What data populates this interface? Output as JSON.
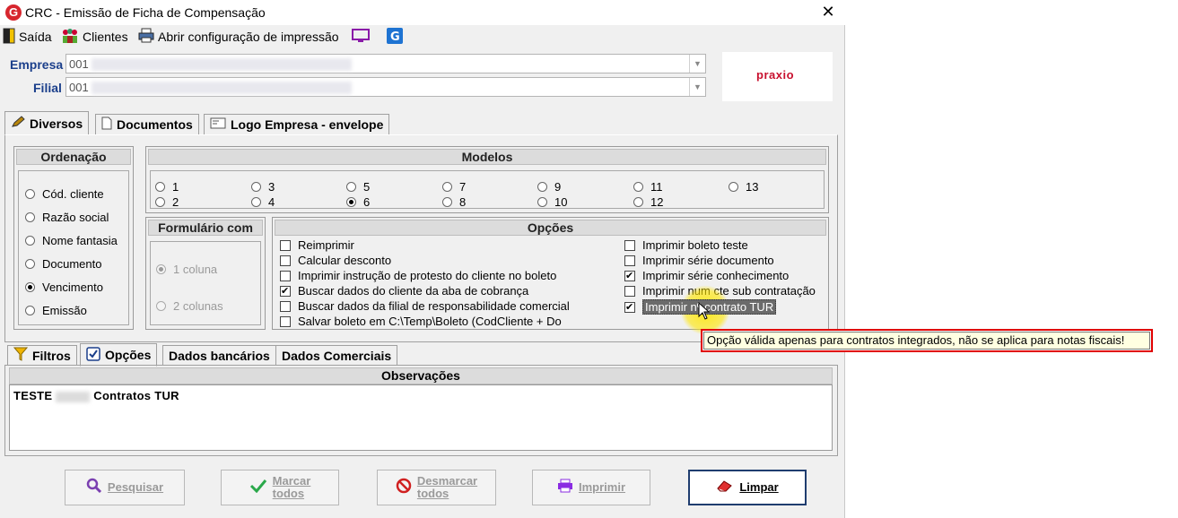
{
  "window": {
    "title": "CRC - Emissão de Ficha de Compensação",
    "close_glyph": "✕",
    "app_icon_letter": "G"
  },
  "toolbar": {
    "exit_label": "Saída",
    "clients_label": "Clientes",
    "print_config_label": "Abrir configuração de impressão"
  },
  "company": {
    "empresa_label": "Empresa",
    "empresa_value": "001",
    "filial_label": "Filial",
    "filial_value": "001",
    "logo_text": "praxio"
  },
  "top_tabs": [
    {
      "label": "Diversos",
      "active": true
    },
    {
      "label": "Documentos",
      "active": false
    },
    {
      "label": "Logo Empresa - envelope",
      "active": false
    }
  ],
  "ordenacao": {
    "title": "Ordenação",
    "options": [
      "Cód. cliente",
      "Razão social",
      "Nome fantasia",
      "Documento",
      "Vencimento",
      "Emissão"
    ],
    "selected": "Vencimento"
  },
  "modelos": {
    "title": "Modelos",
    "options": [
      "1",
      "2",
      "3",
      "4",
      "5",
      "6",
      "7",
      "8",
      "9",
      "10",
      "11",
      "12",
      "13"
    ],
    "selected": "6"
  },
  "formulario": {
    "title": "Formulário com",
    "options": [
      "1 coluna",
      "2 colunas"
    ],
    "selected": "1 coluna"
  },
  "opcoes": {
    "title": "Opções",
    "left": [
      {
        "label": "Reimprimir",
        "checked": false
      },
      {
        "label": "Calcular desconto",
        "checked": false
      },
      {
        "label": "Imprimir instrução de protesto do cliente no boleto",
        "checked": false
      },
      {
        "label": "Buscar dados do cliente da aba de cobrança",
        "checked": true
      },
      {
        "label": "Buscar dados da filial de responsabilidade comercial",
        "checked": false
      },
      {
        "label": "Salvar boleto em C:\\Temp\\Boleto (CodCliente + Do",
        "checked": false
      }
    ],
    "right": [
      {
        "label": "Imprimir boleto teste",
        "checked": false
      },
      {
        "label": "Imprimir série documento",
        "checked": false
      },
      {
        "label": "Imprimir série conhecimento",
        "checked": true
      },
      {
        "label": "Imprimir num cte sub contratação",
        "checked": false
      },
      {
        "label": "Imprimir nº contrato TUR",
        "checked": true
      }
    ]
  },
  "tooltip": {
    "text": "Opção válida apenas para contratos integrados, não se aplica para notas fiscais!"
  },
  "bottom_tabs": [
    {
      "label": "Filtros",
      "active": false
    },
    {
      "label": "Opções",
      "active": true
    },
    {
      "label": "Dados bancários",
      "active": false
    },
    {
      "label": "Dados Comerciais",
      "active": false
    }
  ],
  "observacoes": {
    "title": "Observações",
    "text_prefix": "TESTE",
    "text_suffix": "Contratos TUR"
  },
  "buttons": {
    "pesquisar": "Pesquisar",
    "marcar_todos_1": "Marcar",
    "marcar_todos_2": "todos",
    "desmarcar_todos_1": "Desmarcar",
    "desmarcar_todos_2": "todos",
    "imprimir": "Imprimir",
    "limpar": "Limpar"
  },
  "colors": {
    "label_blue": "#1b3f8b",
    "tooltip_border": "#e00000",
    "tooltip_bg": "#ffffe1",
    "brand_red": "#c8102e"
  }
}
